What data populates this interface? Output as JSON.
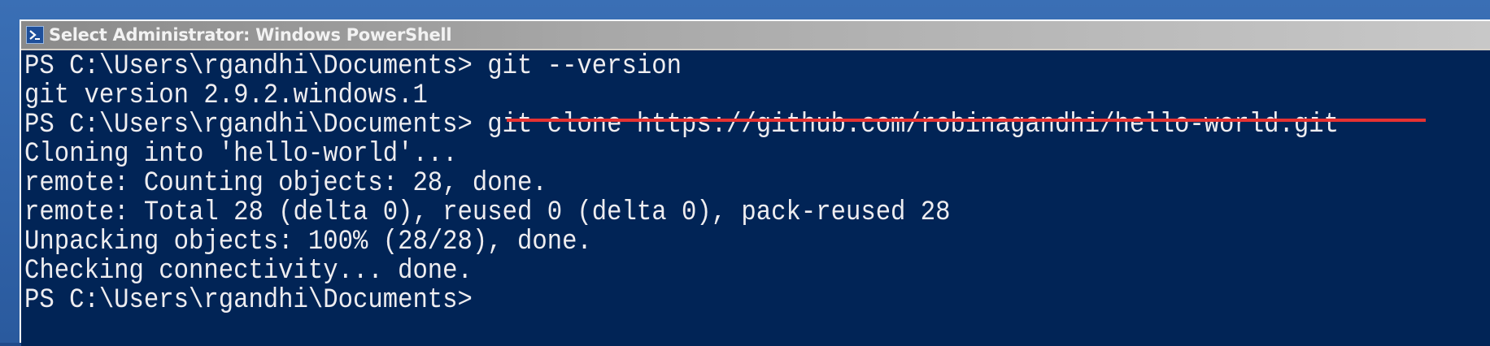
{
  "window": {
    "title": "Select Administrator: Windows PowerShell",
    "icon": "powershell-icon"
  },
  "console": {
    "background": "#012456",
    "foreground": "#eeedf0",
    "lines": [
      "PS C:\\Users\\rgandhi\\Documents> git --version",
      "git version 2.9.2.windows.1",
      "PS C:\\Users\\rgandhi\\Documents> git clone https://github.com/robinagandhi/hello-world.git",
      "Cloning into 'hello-world'...",
      "remote: Counting objects: 28, done.",
      "remote: Total 28 (delta 0), reused 0 (delta 0), pack-reused 28",
      "Unpacking objects: 100% (28/28), done.",
      "Checking connectivity... done.",
      "PS C:\\Users\\rgandhi\\Documents>"
    ]
  },
  "annotation": {
    "color": "#e63232"
  }
}
